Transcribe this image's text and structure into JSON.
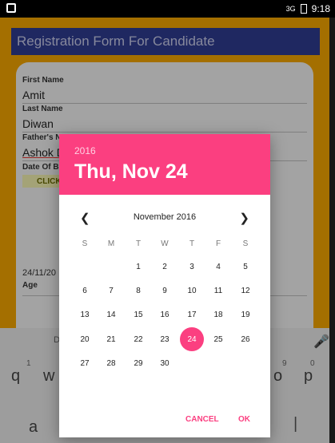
{
  "status_bar": {
    "network": "3G",
    "time": "9:18"
  },
  "app": {
    "title": "Registration Form For Candidate",
    "fields": [
      {
        "label": "First Name",
        "value": "Amit"
      },
      {
        "label": "Last Name",
        "value": "Diwan"
      },
      {
        "label": "Father's N",
        "value": "Ashok D"
      },
      {
        "label": "Date Of B",
        "value": ""
      }
    ],
    "click_button": "CLICK",
    "date_value": "24/11/20",
    "age_label": "Age"
  },
  "keyboard": {
    "digits": [
      "1",
      "9",
      "0"
    ],
    "row_keys": [
      "q",
      "w",
      "o",
      "p"
    ],
    "bottom_left": "a",
    "cursor": "|",
    "partial_top": "D",
    "mic_icon": "microphone-icon"
  },
  "date_picker": {
    "year": "2016",
    "date_header": "Thu, Nov 24",
    "month_label": "November 2016",
    "weekdays": [
      "S",
      "M",
      "T",
      "W",
      "T",
      "F",
      "S"
    ],
    "weeks": [
      [
        "",
        "",
        "1",
        "2",
        "3",
        "4",
        "5"
      ],
      [
        "6",
        "7",
        "8",
        "9",
        "10",
        "11",
        "12"
      ],
      [
        "13",
        "14",
        "15",
        "16",
        "17",
        "18",
        "19"
      ],
      [
        "20",
        "21",
        "22",
        "23",
        "24",
        "25",
        "26"
      ],
      [
        "27",
        "28",
        "29",
        "30",
        "",
        "",
        ""
      ]
    ],
    "selected_day": "24",
    "cancel_label": "CANCEL",
    "ok_label": "OK",
    "accent_color": "#fb3f80"
  }
}
